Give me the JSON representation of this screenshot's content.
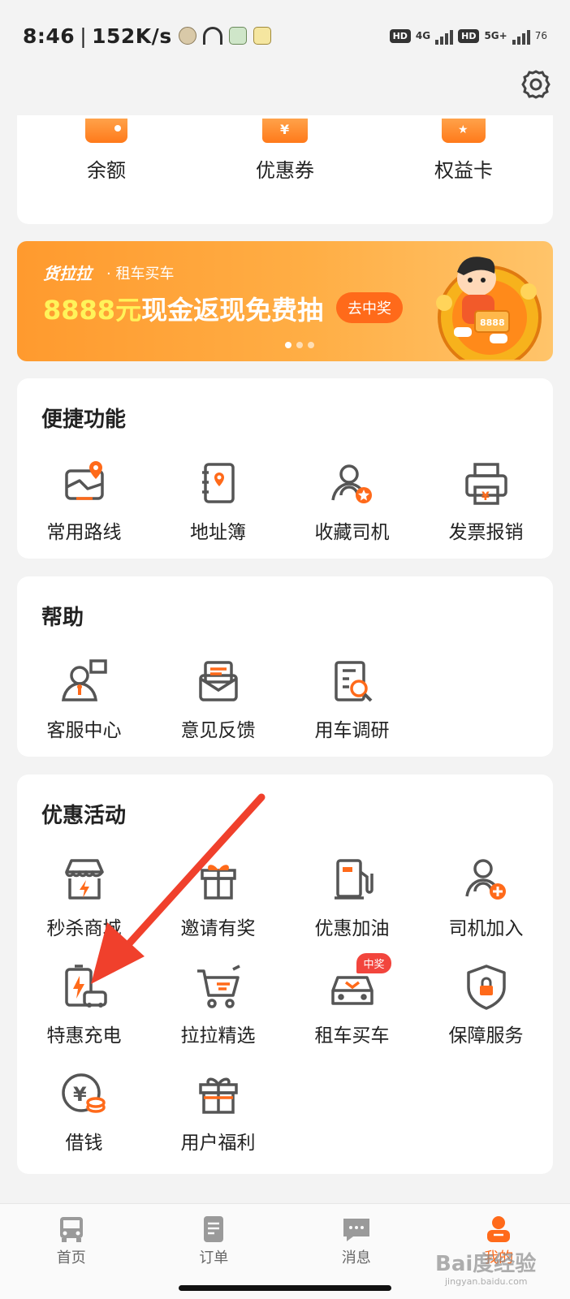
{
  "status_bar": {
    "time": "8:46",
    "speed": "152K/s",
    "net1": "4G",
    "net2": "5G+",
    "battery": "76",
    "hd": "HD"
  },
  "wallet": [
    {
      "label": "余额",
      "icon": "wallet-icon"
    },
    {
      "label": "优惠券",
      "icon": "coupon-icon"
    },
    {
      "label": "权益卡",
      "icon": "benefit-card-icon"
    }
  ],
  "banner": {
    "brand": "货拉拉",
    "sub": "· 租车买车",
    "headline_highlight": "8888元",
    "headline_rest": "现金返现免费抽",
    "cta": "去中奖",
    "art_text": "8888"
  },
  "shortcuts": {
    "title": "便捷功能",
    "items": [
      {
        "label": "常用路线",
        "icon": "route-map-icon"
      },
      {
        "label": "地址簿",
        "icon": "address-book-icon"
      },
      {
        "label": "收藏司机",
        "icon": "favorite-driver-icon"
      },
      {
        "label": "发票报销",
        "icon": "invoice-printer-icon"
      }
    ]
  },
  "help": {
    "title": "帮助",
    "items": [
      {
        "label": "客服中心",
        "icon": "customer-service-icon"
      },
      {
        "label": "意见反馈",
        "icon": "feedback-mail-icon"
      },
      {
        "label": "用车调研",
        "icon": "survey-search-icon"
      }
    ]
  },
  "promotions": {
    "title": "优惠活动",
    "items": [
      {
        "label": "秒杀商城",
        "icon": "flash-store-icon"
      },
      {
        "label": "邀请有奖",
        "icon": "invite-gift-icon"
      },
      {
        "label": "优惠加油",
        "icon": "fuel-pump-icon"
      },
      {
        "label": "司机加入",
        "icon": "driver-join-icon"
      },
      {
        "label": "特惠充电",
        "icon": "ev-charging-icon"
      },
      {
        "label": "拉拉精选",
        "icon": "shopping-cart-icon"
      },
      {
        "label": "租车买车",
        "icon": "car-rental-icon",
        "badge": "中奖"
      },
      {
        "label": "保障服务",
        "icon": "shield-lock-icon"
      },
      {
        "label": "借钱",
        "icon": "loan-coin-icon"
      },
      {
        "label": "用户福利",
        "icon": "user-gift-icon"
      }
    ]
  },
  "bottom_nav": [
    {
      "label": "首页",
      "icon": "truck-home-icon"
    },
    {
      "label": "订单",
      "icon": "order-list-icon"
    },
    {
      "label": "消息",
      "icon": "message-icon"
    },
    {
      "label": "我的",
      "icon": "profile-icon",
      "active": true
    }
  ],
  "watermark": {
    "text": "Bai度经验",
    "sub": "jingyan.baidu.com"
  },
  "colors": {
    "accent": "#ff6a1a",
    "icon_stroke": "#555555",
    "arrow": "#f0402c",
    "badge": "#f2453d"
  }
}
